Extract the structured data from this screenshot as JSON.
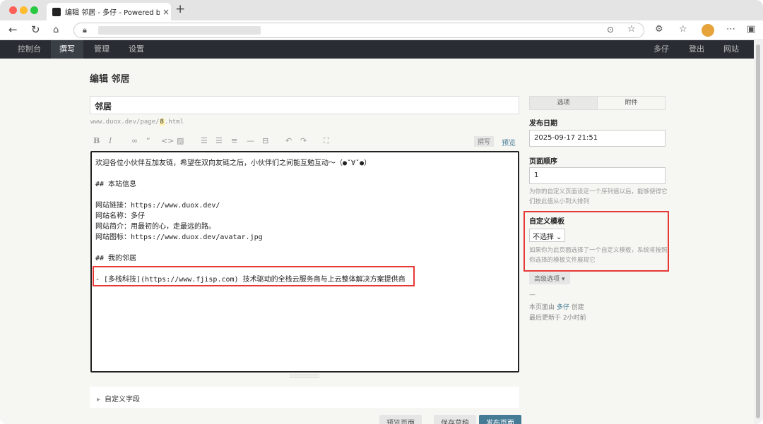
{
  "browser": {
    "tab_title": "编辑 邻居 - 多仔 - Powered by T",
    "close_glyph": "×",
    "new_tab_glyph": "+"
  },
  "admin_nav": {
    "left": [
      "控制台",
      "撰写",
      "管理",
      "设置"
    ],
    "active_index": 1,
    "right": [
      "多仔",
      "登出",
      "网站"
    ]
  },
  "page": {
    "title": "编辑 邻居",
    "page_title_value": "邻居",
    "permalink_prefix": "www.duox.dev/page/",
    "permalink_slug": "8",
    "permalink_suffix": ".html",
    "mode_write": "撰写",
    "mode_preview": "预览",
    "editor_lines": [
      "欢迎各位小伙伴互加友链，希望在双向友链之后，小伙伴们之间能互勉互动～（●ˇ∀ˇ●）",
      "",
      "## 本站信息",
      "",
      "网站链接：https://www.duox.dev/",
      "网站名称：多仔",
      "网站简介：用最初的心，走最远的路。",
      "网站图标：https://www.duox.dev/avatar.jpg",
      "",
      "## 我的邻居",
      "",
      "- [多栈科技](https://www.fjisp.com) 技术驱动的全栈云服务商与上云整体解决方案提供商"
    ],
    "custom_fields_label": "自定义字段",
    "buttons": [
      "预览页面",
      "保存草稿",
      "发布页面"
    ]
  },
  "sidebar": {
    "tabs": [
      "选项",
      "附件"
    ],
    "publish_date_label": "发布日期",
    "publish_date_value": "2025-09-17 21:51",
    "order_label": "页面顺序",
    "order_value": "1",
    "order_desc": "为你的自定义页面设定一个序列值以后，能够使得它们按此值从小到大排列",
    "template_label": "自定义模板",
    "template_value": "不选择",
    "template_desc": "如果你为此页面选择了一个自定义模板，系统将按照你选择的模板文件展现它",
    "advanced_label": "高级选项",
    "meta_dash": "—",
    "created_by_prefix": "本页面由",
    "author": "多仔",
    "created_by_suffix": "创建",
    "last_updated": "最后更新于 2小时前"
  },
  "colors": {
    "admin_bar": "#292d33",
    "link": "#467b96",
    "publish_button": "#467b96",
    "highlight": "#e53935"
  }
}
